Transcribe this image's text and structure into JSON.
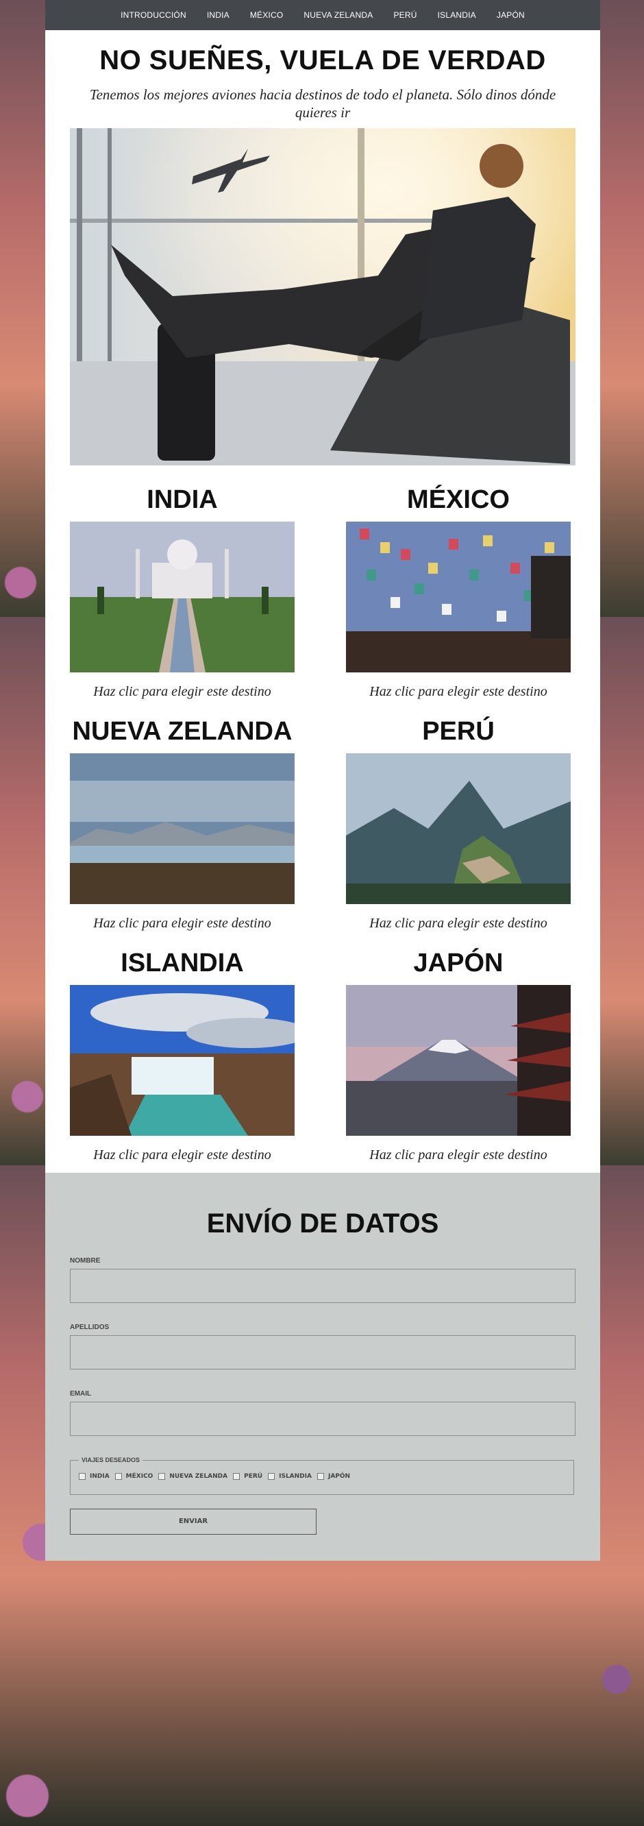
{
  "nav": {
    "items": [
      "INTRODUCCIÓN",
      "INDIA",
      "MÉXICO",
      "NUEVA ZELANDA",
      "PERÚ",
      "ISLANDIA",
      "JAPÓN"
    ]
  },
  "hero": {
    "title": "NO SUEÑES, VUELA DE VERDAD",
    "subtitle": "Tenemos los mejores aviones hacia destinos de todo el planeta. Sólo dinos dónde quieres ir"
  },
  "destinations": [
    {
      "name": "INDIA",
      "cta": "Haz clic para elegir este destino"
    },
    {
      "name": "MÉXICO",
      "cta": "Haz clic para elegir este destino"
    },
    {
      "name": "NUEVA ZELANDA",
      "cta": "Haz clic para elegir este destino"
    },
    {
      "name": "PERÚ",
      "cta": "Haz clic para elegir este destino"
    },
    {
      "name": "ISLANDIA",
      "cta": "Haz clic para elegir este destino"
    },
    {
      "name": "JAPÓN",
      "cta": "Haz clic para elegir este destino"
    }
  ],
  "form": {
    "title": "ENVÍO DE DATOS",
    "nombre_label": "NOMBRE",
    "apellidos_label": "APELLIDOS",
    "email_label": "EMAIL",
    "viajes_legend": "VIAJES DESEADOS",
    "options": [
      "INDIA",
      "MÉXICO",
      "NUEVA ZELANDA",
      "PERÚ",
      "ISLANDIA",
      "JAPÓN"
    ],
    "submit_label": "ENVIAR"
  },
  "colors": {
    "nav_bg": "#44474c",
    "form_bg": "#c9cdcc"
  }
}
